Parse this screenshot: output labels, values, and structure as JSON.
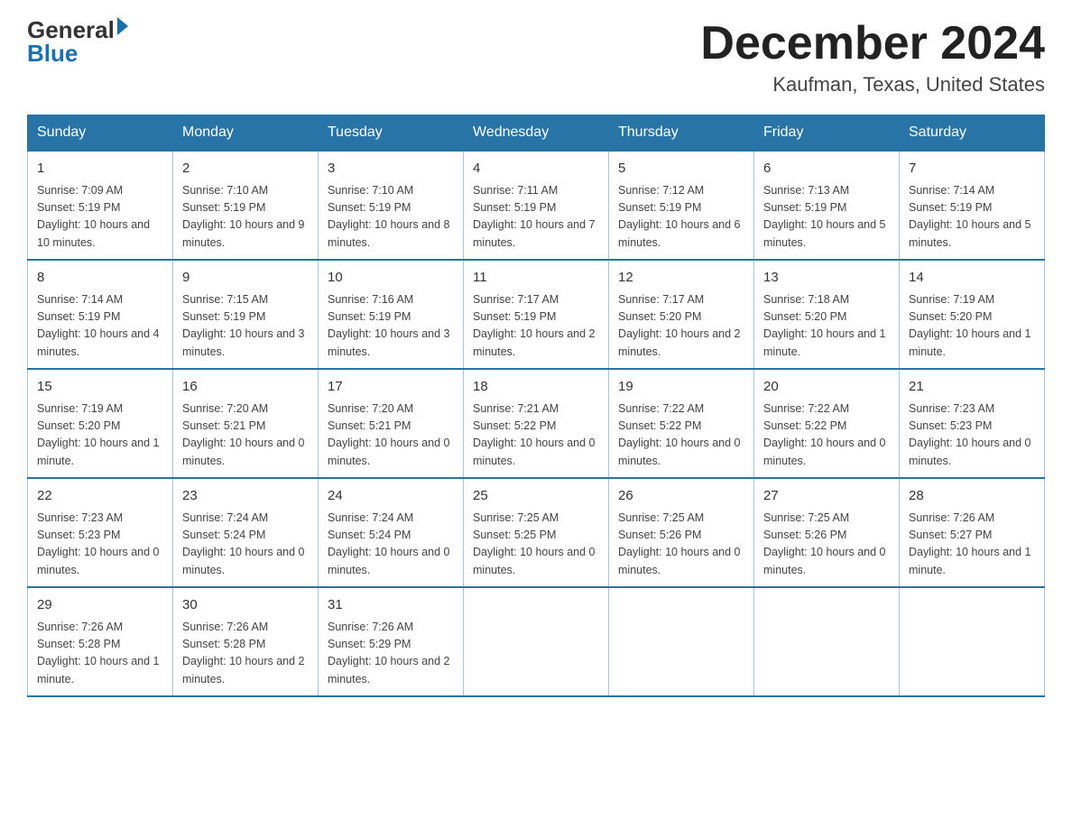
{
  "logo": {
    "text_general": "General",
    "text_blue": "Blue",
    "arrow": "▶"
  },
  "title": {
    "month": "December 2024",
    "location": "Kaufman, Texas, United States"
  },
  "days_of_week": [
    "Sunday",
    "Monday",
    "Tuesday",
    "Wednesday",
    "Thursday",
    "Friday",
    "Saturday"
  ],
  "weeks": [
    [
      {
        "day": "1",
        "sunrise": "7:09 AM",
        "sunset": "5:19 PM",
        "daylight": "10 hours and 10 minutes."
      },
      {
        "day": "2",
        "sunrise": "7:10 AM",
        "sunset": "5:19 PM",
        "daylight": "10 hours and 9 minutes."
      },
      {
        "day": "3",
        "sunrise": "7:10 AM",
        "sunset": "5:19 PM",
        "daylight": "10 hours and 8 minutes."
      },
      {
        "day": "4",
        "sunrise": "7:11 AM",
        "sunset": "5:19 PM",
        "daylight": "10 hours and 7 minutes."
      },
      {
        "day": "5",
        "sunrise": "7:12 AM",
        "sunset": "5:19 PM",
        "daylight": "10 hours and 6 minutes."
      },
      {
        "day": "6",
        "sunrise": "7:13 AM",
        "sunset": "5:19 PM",
        "daylight": "10 hours and 5 minutes."
      },
      {
        "day": "7",
        "sunrise": "7:14 AM",
        "sunset": "5:19 PM",
        "daylight": "10 hours and 5 minutes."
      }
    ],
    [
      {
        "day": "8",
        "sunrise": "7:14 AM",
        "sunset": "5:19 PM",
        "daylight": "10 hours and 4 minutes."
      },
      {
        "day": "9",
        "sunrise": "7:15 AM",
        "sunset": "5:19 PM",
        "daylight": "10 hours and 3 minutes."
      },
      {
        "day": "10",
        "sunrise": "7:16 AM",
        "sunset": "5:19 PM",
        "daylight": "10 hours and 3 minutes."
      },
      {
        "day": "11",
        "sunrise": "7:17 AM",
        "sunset": "5:19 PM",
        "daylight": "10 hours and 2 minutes."
      },
      {
        "day": "12",
        "sunrise": "7:17 AM",
        "sunset": "5:20 PM",
        "daylight": "10 hours and 2 minutes."
      },
      {
        "day": "13",
        "sunrise": "7:18 AM",
        "sunset": "5:20 PM",
        "daylight": "10 hours and 1 minute."
      },
      {
        "day": "14",
        "sunrise": "7:19 AM",
        "sunset": "5:20 PM",
        "daylight": "10 hours and 1 minute."
      }
    ],
    [
      {
        "day": "15",
        "sunrise": "7:19 AM",
        "sunset": "5:20 PM",
        "daylight": "10 hours and 1 minute."
      },
      {
        "day": "16",
        "sunrise": "7:20 AM",
        "sunset": "5:21 PM",
        "daylight": "10 hours and 0 minutes."
      },
      {
        "day": "17",
        "sunrise": "7:20 AM",
        "sunset": "5:21 PM",
        "daylight": "10 hours and 0 minutes."
      },
      {
        "day": "18",
        "sunrise": "7:21 AM",
        "sunset": "5:22 PM",
        "daylight": "10 hours and 0 minutes."
      },
      {
        "day": "19",
        "sunrise": "7:22 AM",
        "sunset": "5:22 PM",
        "daylight": "10 hours and 0 minutes."
      },
      {
        "day": "20",
        "sunrise": "7:22 AM",
        "sunset": "5:22 PM",
        "daylight": "10 hours and 0 minutes."
      },
      {
        "day": "21",
        "sunrise": "7:23 AM",
        "sunset": "5:23 PM",
        "daylight": "10 hours and 0 minutes."
      }
    ],
    [
      {
        "day": "22",
        "sunrise": "7:23 AM",
        "sunset": "5:23 PM",
        "daylight": "10 hours and 0 minutes."
      },
      {
        "day": "23",
        "sunrise": "7:24 AM",
        "sunset": "5:24 PM",
        "daylight": "10 hours and 0 minutes."
      },
      {
        "day": "24",
        "sunrise": "7:24 AM",
        "sunset": "5:24 PM",
        "daylight": "10 hours and 0 minutes."
      },
      {
        "day": "25",
        "sunrise": "7:25 AM",
        "sunset": "5:25 PM",
        "daylight": "10 hours and 0 minutes."
      },
      {
        "day": "26",
        "sunrise": "7:25 AM",
        "sunset": "5:26 PM",
        "daylight": "10 hours and 0 minutes."
      },
      {
        "day": "27",
        "sunrise": "7:25 AM",
        "sunset": "5:26 PM",
        "daylight": "10 hours and 0 minutes."
      },
      {
        "day": "28",
        "sunrise": "7:26 AM",
        "sunset": "5:27 PM",
        "daylight": "10 hours and 1 minute."
      }
    ],
    [
      {
        "day": "29",
        "sunrise": "7:26 AM",
        "sunset": "5:28 PM",
        "daylight": "10 hours and 1 minute."
      },
      {
        "day": "30",
        "sunrise": "7:26 AM",
        "sunset": "5:28 PM",
        "daylight": "10 hours and 2 minutes."
      },
      {
        "day": "31",
        "sunrise": "7:26 AM",
        "sunset": "5:29 PM",
        "daylight": "10 hours and 2 minutes."
      },
      null,
      null,
      null,
      null
    ]
  ],
  "labels": {
    "sunrise": "Sunrise:",
    "sunset": "Sunset:",
    "daylight": "Daylight:"
  }
}
